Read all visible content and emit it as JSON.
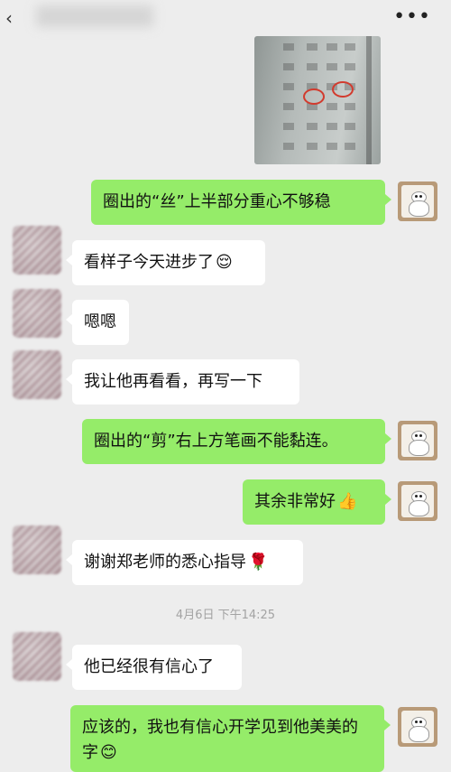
{
  "header": {
    "back_icon": "‹",
    "more_icon": "•••"
  },
  "messages": [
    {
      "side": "out",
      "text": "圈出的“丝”上半部分重心不够稳"
    },
    {
      "side": "in",
      "text": "看样子今天进步了",
      "emoji": "😌"
    },
    {
      "side": "in",
      "text": "嗯嗯"
    },
    {
      "side": "in",
      "text": "我让他再看看，再写一下"
    },
    {
      "side": "out",
      "text": "圈出的“剪”右上方笔画不能黏连。"
    },
    {
      "side": "out",
      "text": "其余非常好",
      "emoji": "👍"
    },
    {
      "side": "in",
      "text": "谢谢郑老师的悉心指导",
      "emoji": "🌹"
    },
    {
      "side": "in",
      "text": "他已经很有信心了"
    },
    {
      "side": "out",
      "text": "应该的，我也有信心开学见到他美美的字",
      "emoji": "😊"
    }
  ],
  "timestamp": "4月6日 下午14:25",
  "colors": {
    "sent_bubble": "#95ec69",
    "received_bubble": "#ffffff",
    "background": "#ededed"
  }
}
